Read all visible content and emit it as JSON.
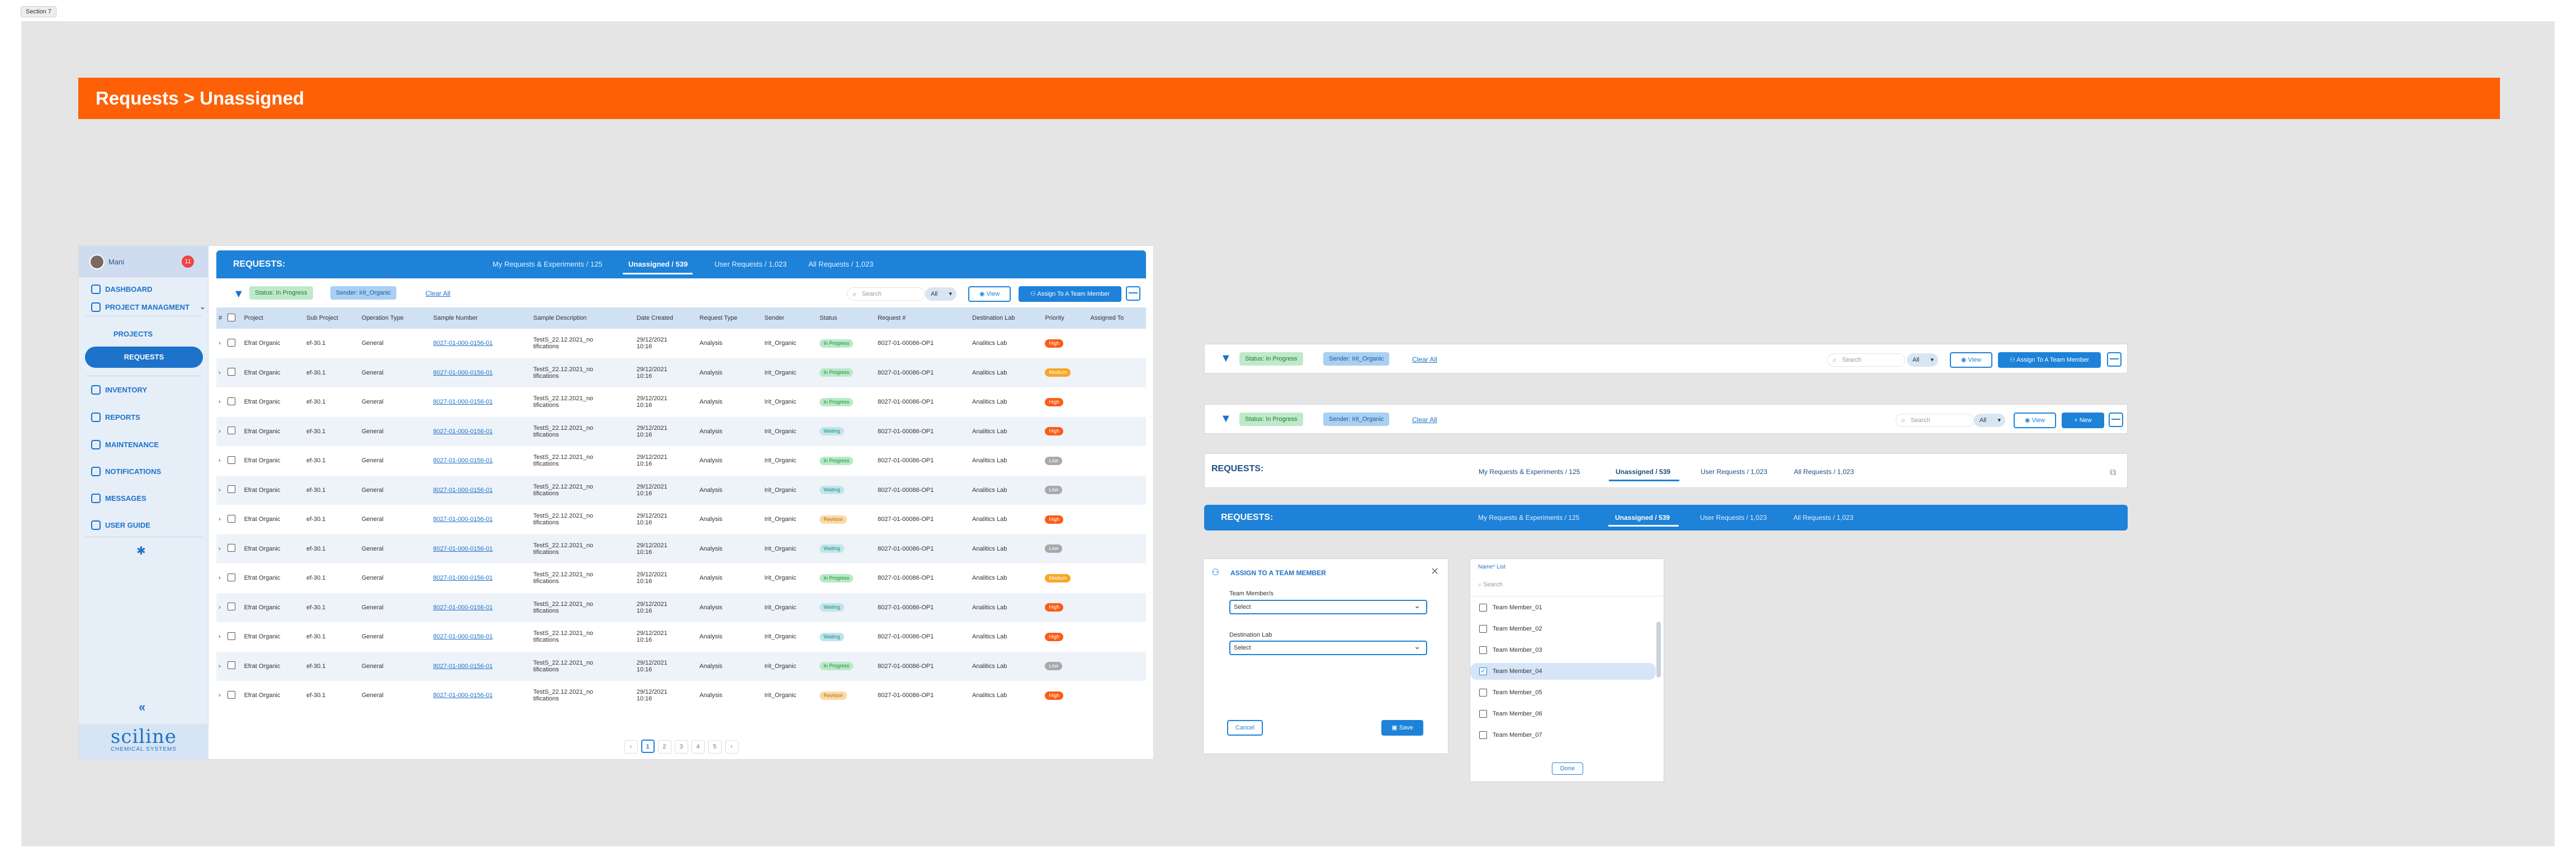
{
  "section_tag": "Section 7",
  "banner": {
    "title": "Requests > Unassigned"
  },
  "sidebar": {
    "user_name": "Mani",
    "notification_count": "11",
    "items": [
      "DASHBOARD",
      "PROJECT MANAGMENT",
      "PROJECTS",
      "REQUESTS",
      "INVENTORY",
      "REPORTS",
      "MAINTENANCE",
      "NOTIFICATIONS",
      "MESSAGES",
      "USER GUIDE"
    ],
    "collapse": "«",
    "logo_main": "sciline",
    "logo_sub": "CHEMICAL SYSTEMS"
  },
  "header": {
    "title": "REQUESTS:",
    "tabs": [
      "My Requests & Experiments / 125",
      "Unassigned / 539",
      "User Requests / 1,023",
      "All Requests / 1,023"
    ]
  },
  "toolbar": {
    "chip_status": "Status: In Progress",
    "chip_sender": "Sender: Irit_Organic",
    "clear_all": "Clear All",
    "search_placeholder": "Search",
    "select_value": "All",
    "view_label": "View",
    "assign_label": "Assign To A Team Member",
    "new_label": "New"
  },
  "table": {
    "columns": [
      "#",
      "",
      "Project",
      "Sub Project",
      "Operation Type",
      "Sample Number",
      "Sample Description",
      "Date Created",
      "Request Type",
      "Sender",
      "Status",
      "Request #",
      "Destination Lab",
      "Priority",
      "Assigned To"
    ],
    "rows": [
      {
        "project": "Efrat Organic",
        "sub": "ef-30.1",
        "op": "General",
        "sample": "8027-01-000-0156-01",
        "desc": "TestS_22.12.2021_notifications",
        "date": "29/12/2021 10:16",
        "rtype": "Analysis",
        "sender": "Irit_Organic",
        "status": "In Progress",
        "req": "8027-01-00086-OP1",
        "lab": "Analitics Lab",
        "priority": "High"
      },
      {
        "project": "Efrat Organic",
        "sub": "ef-30.1",
        "op": "General",
        "sample": "8027-01-000-0156-01",
        "desc": "TestS_22.12.2021_notifications",
        "date": "29/12/2021 10:16",
        "rtype": "Analysis",
        "sender": "Irit_Organic",
        "status": "In Progress",
        "req": "8027-01-00086-OP1",
        "lab": "Analitics Lab",
        "priority": "Medium"
      },
      {
        "project": "Efrat Organic",
        "sub": "ef-30.1",
        "op": "General",
        "sample": "8027-01-000-0156-01",
        "desc": "TestS_22.12.2021_notifications",
        "date": "29/12/2021 10:16",
        "rtype": "Analysis",
        "sender": "Irit_Organic",
        "status": "In Progress",
        "req": "8027-01-00086-OP1",
        "lab": "Analitics Lab",
        "priority": "High"
      },
      {
        "project": "Efrat Organic",
        "sub": "ef-30.1",
        "op": "General",
        "sample": "8027-01-000-0156-01",
        "desc": "TestS_22.12.2021_notifications",
        "date": "29/12/2021 10:16",
        "rtype": "Analysis",
        "sender": "Irit_Organic",
        "status": "Waiting",
        "req": "8027-01-00086-OP1",
        "lab": "Analitics Lab",
        "priority": "High"
      },
      {
        "project": "Efrat Organic",
        "sub": "ef-30.1",
        "op": "General",
        "sample": "8027-01-000-0156-01",
        "desc": "TestS_22.12.2021_notifications",
        "date": "29/12/2021 10:16",
        "rtype": "Analysis",
        "sender": "Irit_Organic",
        "status": "In Progress",
        "req": "8027-01-00086-OP1",
        "lab": "Analitics Lab",
        "priority": "Low"
      },
      {
        "project": "Efrat Organic",
        "sub": "ef-30.1",
        "op": "General",
        "sample": "8027-01-000-0156-01",
        "desc": "TestS_22.12.2021_notifications",
        "date": "29/12/2021 10:16",
        "rtype": "Analysis",
        "sender": "Irit_Organic",
        "status": "Waiting",
        "req": "8027-01-00086-OP1",
        "lab": "Analitics Lab",
        "priority": "Low"
      },
      {
        "project": "Efrat Organic",
        "sub": "ef-30.1",
        "op": "General",
        "sample": "8027-01-000-0156-01",
        "desc": "TestS_22.12.2021_notifications",
        "date": "29/12/2021 10:16",
        "rtype": "Analysis",
        "sender": "Irit_Organic",
        "status": "Revision",
        "req": "8027-01-00086-OP1",
        "lab": "Analitics Lab",
        "priority": "High"
      },
      {
        "project": "Efrat Organic",
        "sub": "ef-30.1",
        "op": "General",
        "sample": "8027-01-000-0156-01",
        "desc": "TestS_22.12.2021_notifications",
        "date": "29/12/2021 10:16",
        "rtype": "Analysis",
        "sender": "Irit_Organic",
        "status": "Waiting",
        "req": "8027-01-00086-OP1",
        "lab": "Analitics Lab",
        "priority": "Low"
      },
      {
        "project": "Efrat Organic",
        "sub": "ef-30.1",
        "op": "General",
        "sample": "8027-01-000-0156-01",
        "desc": "TestS_22.12.2021_notifications",
        "date": "29/12/2021 10:16",
        "rtype": "Analysis",
        "sender": "Irit_Organic",
        "status": "In Progress",
        "req": "8027-01-00086-OP1",
        "lab": "Analitics Lab",
        "priority": "Medium"
      },
      {
        "project": "Efrat Organic",
        "sub": "ef-30.1",
        "op": "General",
        "sample": "8027-01-000-0156-01",
        "desc": "TestS_22.12.2021_notifications",
        "date": "29/12/2021 10:16",
        "rtype": "Analysis",
        "sender": "Irit_Organic",
        "status": "Waiting",
        "req": "8027-01-00086-OP1",
        "lab": "Analitics Lab",
        "priority": "High"
      },
      {
        "project": "Efrat Organic",
        "sub": "ef-30.1",
        "op": "General",
        "sample": "8027-01-000-0156-01",
        "desc": "TestS_22.12.2021_notifications",
        "date": "29/12/2021 10:16",
        "rtype": "Analysis",
        "sender": "Irit_Organic",
        "status": "Waiting",
        "req": "8027-01-00086-OP1",
        "lab": "Analitics Lab",
        "priority": "High"
      },
      {
        "project": "Efrat Organic",
        "sub": "ef-30.1",
        "op": "General",
        "sample": "8027-01-000-0156-01",
        "desc": "TestS_22.12.2021_notifications",
        "date": "29/12/2021 10:16",
        "rtype": "Analysis",
        "sender": "Irit_Organic",
        "status": "In Progress",
        "req": "8027-01-00086-OP1",
        "lab": "Analitics Lab",
        "priority": "Low"
      },
      {
        "project": "Efrat Organic",
        "sub": "ef-30.1",
        "op": "General",
        "sample": "8027-01-000-0156-01",
        "desc": "TestS_22.12.2021_notifications",
        "date": "29/12/2021 10:16",
        "rtype": "Analysis",
        "sender": "Irit_Organic",
        "status": "Revision",
        "req": "8027-01-00086-OP1",
        "lab": "Analitics Lab",
        "priority": "High"
      }
    ]
  },
  "pagination": {
    "pages": [
      "‹",
      "1",
      "2",
      "3",
      "4",
      "5",
      "›"
    ],
    "current": "1"
  },
  "modal": {
    "title": "ASSIGN TO A TEAM MEMBER",
    "label_members": "Team Member/s",
    "label_lab": "Destination Lab",
    "select_placeholder": "Select",
    "cancel": "Cancel",
    "save": "Save"
  },
  "member_list": {
    "header": "Name* List",
    "search_placeholder": "Search",
    "members": [
      "Team Member_01",
      "Team Member_02",
      "Team Member_03",
      "Team Member_04",
      "Team Member_05",
      "Team Member_06",
      "Team Member_07"
    ],
    "selected": "Team Member_04",
    "done": "Done"
  },
  "colors": {
    "accent": "#1d82d8",
    "banner": "#fd6007",
    "danger": "#fb5c16"
  }
}
